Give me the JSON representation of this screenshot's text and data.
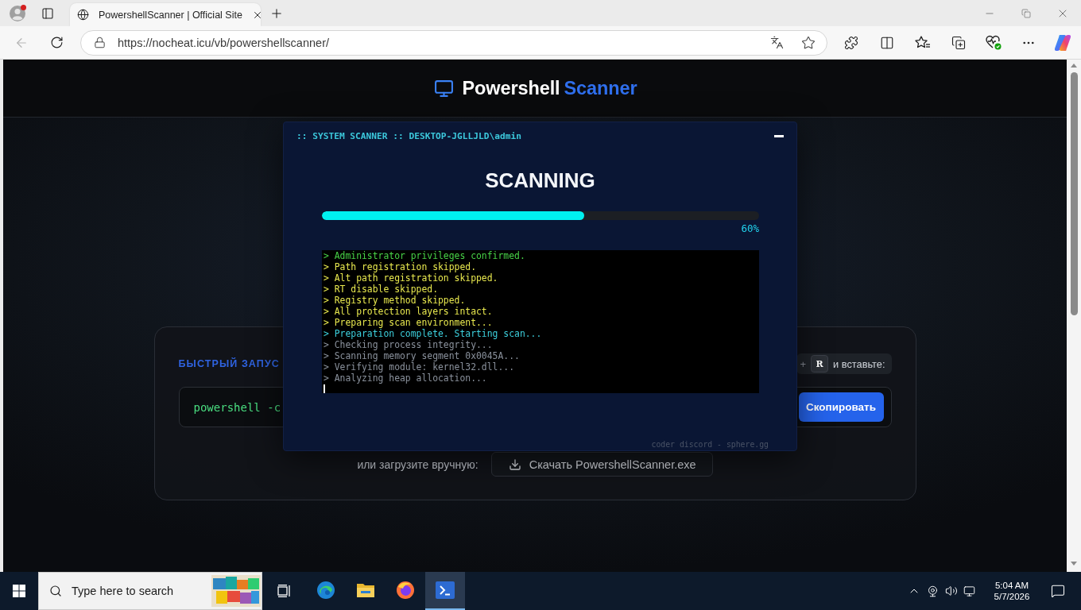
{
  "browser": {
    "tab_title": "PowershellScanner | Official Site",
    "url": "https://nocheat.icu/vb/powershellscanner/"
  },
  "header": {
    "logo_text": "Powershell",
    "logo_accent": "Scanner"
  },
  "quick_start": {
    "title": "БЫСТРЫЙ ЗАПУС",
    "hint_plus": "+",
    "hint_key": "R",
    "hint_text": "и вставьте:",
    "command": "powershell -c",
    "copy_button": "Скопировать",
    "download_label": "или загрузите вручную:",
    "download_button": "Скачать PowershellScanner.exe"
  },
  "scanner_modal": {
    "title": ":: SYSTEM SCANNER :: DESKTOP-JGLLJLD\\admin",
    "heading": "SCANNING",
    "progress": {
      "level": 0.6,
      "reading": "60%"
    },
    "log": [
      {
        "text": "> Administrator privileges confirmed.",
        "color": "#47d147"
      },
      {
        "text": "> Path registration skipped.",
        "color": "#e8e84e"
      },
      {
        "text": "> Alt path registration skipped.",
        "color": "#e8e84e"
      },
      {
        "text": "> RT disable skipped.",
        "color": "#e8e84e"
      },
      {
        "text": "> Registry method skipped.",
        "color": "#e8e84e"
      },
      {
        "text": "> All protection layers intact.",
        "color": "#e8e84e"
      },
      {
        "text": "> Preparing scan environment...",
        "color": "#e8e84e"
      },
      {
        "text": "> Preparation complete. Starting scan...",
        "color": "#3ccfdc"
      },
      {
        "text": "> Checking process integrity...",
        "color": "#8a919c"
      },
      {
        "text": "> Scanning memory segment 0x0045A...",
        "color": "#8a919c"
      },
      {
        "text": "> Verifying module: kernel32.dll...",
        "color": "#8a919c"
      },
      {
        "text": "> Analyzing heap allocation...",
        "color": "#8a919c"
      }
    ],
    "footer": "coder discord - sphere.gg"
  },
  "taskbar": {
    "search": {
      "placeholder": "Type here to search"
    },
    "apps": [
      {
        "kind": "edge",
        "selected": false
      },
      {
        "kind": "file-explorer",
        "selected": false
      },
      {
        "kind": "firefox",
        "selected": false
      },
      {
        "kind": "powershell",
        "selected": true
      }
    ],
    "time": "5:04 AM",
    "date": "5/7/2026"
  }
}
